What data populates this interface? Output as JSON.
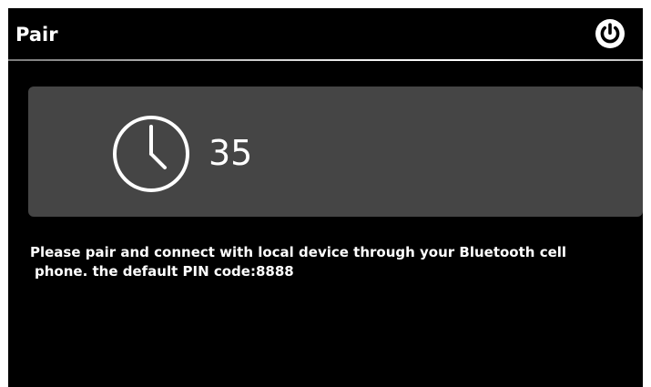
{
  "header": {
    "title": "Pair",
    "power_icon": "power-icon"
  },
  "timer": {
    "icon": "clock-icon",
    "seconds": "35"
  },
  "message": {
    "line1": "Please pair and connect with local device through your Bluetooth cell",
    "line2": "phone. the default PIN code:8888"
  },
  "colors": {
    "background": "#000000",
    "panel": "#454545",
    "text": "#ffffff"
  }
}
